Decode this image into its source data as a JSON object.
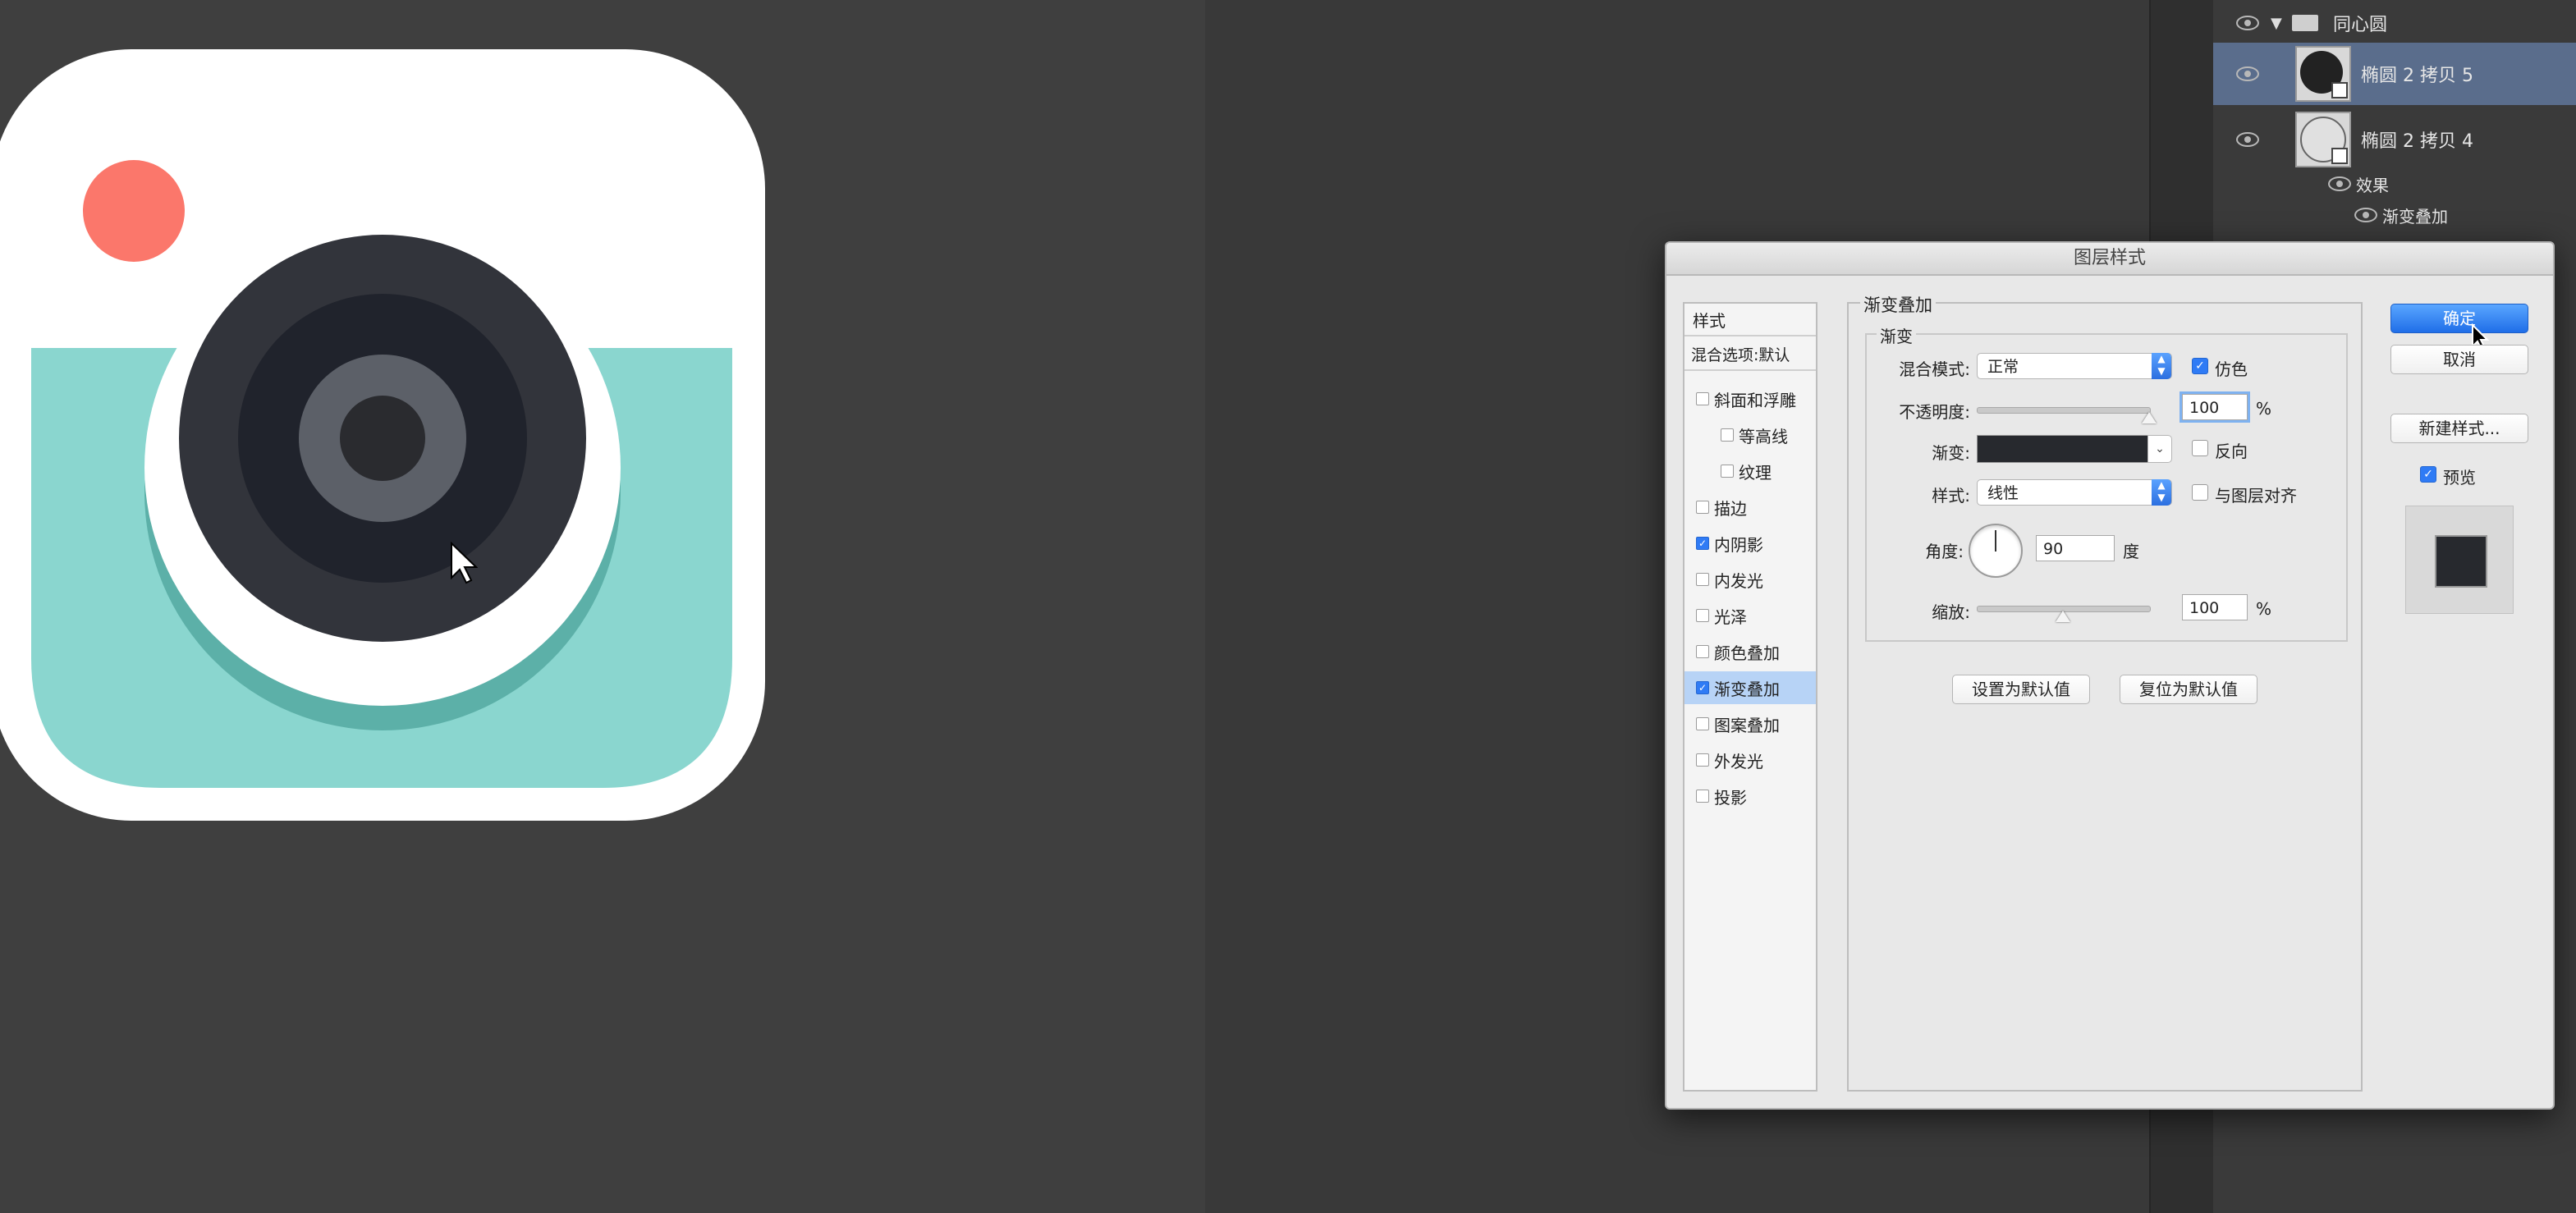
{
  "layers": {
    "group_name": "同心圆",
    "layer1_name": "椭圆 2 拷贝 5",
    "layer2_name": "椭圆 2 拷贝 4",
    "effects_label": "效果",
    "effect_item": "渐变叠加"
  },
  "dialog": {
    "title": "图层样式",
    "styles_header": "样式",
    "blend_options": "混合选项:默认",
    "styles": [
      {
        "label": "斜面和浮雕",
        "checked": false
      },
      {
        "label": "等高线",
        "checked": false
      },
      {
        "label": "纹理",
        "checked": false
      },
      {
        "label": "描边",
        "checked": false
      },
      {
        "label": "内阴影",
        "checked": true
      },
      {
        "label": "内发光",
        "checked": false
      },
      {
        "label": "光泽",
        "checked": false
      },
      {
        "label": "颜色叠加",
        "checked": false
      },
      {
        "label": "渐变叠加",
        "checked": true
      },
      {
        "label": "图案叠加",
        "checked": false
      },
      {
        "label": "外发光",
        "checked": false
      },
      {
        "label": "投影",
        "checked": false
      }
    ],
    "group_title": "渐变叠加",
    "inner_title": "渐变",
    "blend_mode_label": "混合模式:",
    "blend_mode_value": "正常",
    "dither_label": "仿色",
    "dither_checked": true,
    "opacity_label": "不透明度:",
    "opacity_value": "100",
    "opacity_unit": "%",
    "opacity_level": 1.0,
    "gradient_label": "渐变:",
    "reverse_label": "反向",
    "reverse_checked": false,
    "style_label": "样式:",
    "style_value": "线性",
    "align_label": "与图层对齐",
    "align_checked": false,
    "angle_label": "角度:",
    "angle_value": "90",
    "angle_unit": "度",
    "scale_label": "缩放:",
    "scale_value": "100",
    "scale_unit": "%",
    "scale_level": 0.5,
    "make_default": "设置为默认值",
    "reset_default": "复位为默认值",
    "ok": "确定",
    "cancel": "取消",
    "new_style": "新建样式...",
    "preview_label": "预览",
    "preview_checked": true
  },
  "colors": {
    "accent": "#2f7bf5",
    "icon_teal": "#8ad6cf",
    "icon_red_dot": "#fb776b",
    "icon_white": "#ffffff",
    "lens_dark": "#272a33"
  }
}
